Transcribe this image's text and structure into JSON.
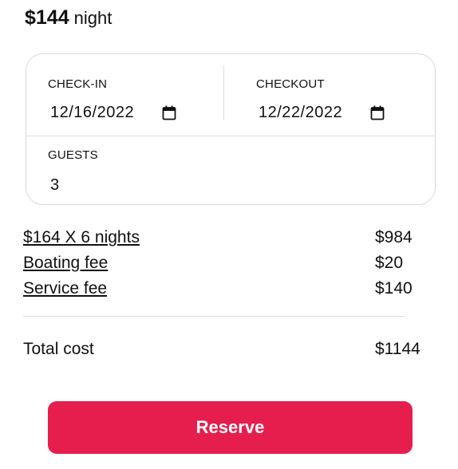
{
  "listing": {
    "price": "$144",
    "price_unit": "night"
  },
  "booking": {
    "checkin": {
      "label": "CHECK-IN",
      "value": "12/16/2022",
      "icon": "calendar-icon"
    },
    "checkout": {
      "label": "CHECKOUT",
      "value": "12/22/2022",
      "icon": "calendar-icon"
    },
    "guests": {
      "label": "GUESTS",
      "value": "3"
    }
  },
  "fees": [
    {
      "label": "$164 X 6 nights",
      "value": "$984"
    },
    {
      "label": "Boating fee",
      "value": "$20"
    },
    {
      "label": "Service fee",
      "value": "$140"
    }
  ],
  "total": {
    "label": "Total cost",
    "value": "$1144"
  },
  "reserve": {
    "label": "Reserve"
  },
  "colors": {
    "accent": "#e61e4d",
    "border": "#d8d8d8",
    "text": "#111111"
  }
}
